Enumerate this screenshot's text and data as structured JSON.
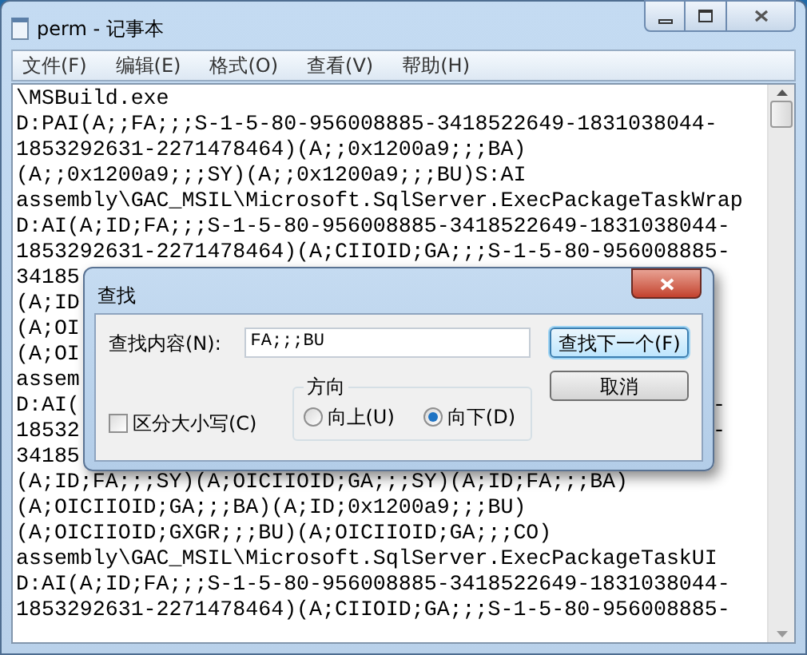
{
  "window": {
    "title": "perm - 记事本"
  },
  "menu": [
    "文件(F)",
    "编辑(E)",
    "格式(O)",
    "查看(V)",
    "帮助(H)"
  ],
  "document_lines": [
    {
      "text": "\\MSBuild.exe"
    },
    {
      "text": "D:PAI(A;;FA;;;S-1-5-80-956008885-3418522649-1831038044-"
    },
    {
      "text": "1853292631-2271478464)(A;;0x1200a9;;;BA)"
    },
    {
      "text": "(A;;0x1200a9;;;SY)(A;;0x1200a9;;;BU)S:AI"
    },
    {
      "text": "assembly\\GAC_MSIL\\Microsoft.SqlServer.ExecPackageTaskWrap"
    },
    {
      "text": "D:AI(A;ID;FA;;;S-1-5-80-956008885-3418522649-1831038044-"
    },
    {
      "text": "1853292631-2271478464)(A;CIIOID;GA;;;S-1-5-80-956008885-"
    },
    {
      "text": "34185"
    },
    {
      "text": "(A;ID"
    },
    {
      "text": "(A;OI"
    },
    {
      "text": "(A;OI"
    },
    {
      "text": "assem"
    },
    {
      "text": "D:AI(",
      "tail": "-"
    },
    {
      "text": "18532",
      "tail": "-"
    },
    {
      "text": "34185"
    },
    {
      "text": "(A;ID;FA;;;SY)(A;OICIIOID;GA;;;SY)(A;ID;FA;;;BA)"
    },
    {
      "text": "(A;OICIIOID;GA;;;BA)(A;ID;0x1200a9;;;BU)"
    },
    {
      "text": "(A;OICIIOID;GXGR;;;BU)(A;OICIIOID;GA;;;CO)"
    },
    {
      "text": "assembly\\GAC_MSIL\\Microsoft.SqlServer.ExecPackageTaskUI"
    },
    {
      "text": "D:AI(A;ID;FA;;;S-1-5-80-956008885-3418522649-1831038044-"
    },
    {
      "text": "1853292631-2271478464)(A;CIIOID;GA;;;S-1-5-80-956008885-"
    }
  ],
  "find_dialog": {
    "title": "查找",
    "find_label": "查找内容(N):",
    "find_value": "FA;;;BU",
    "find_next_button": "查找下一个(F)",
    "cancel_button": "取消",
    "match_case": {
      "label": "区分大小写(C)",
      "checked": false
    },
    "direction": {
      "label": "方向",
      "options": [
        {
          "label": "向上(U)",
          "selected": false
        },
        {
          "label": "向下(D)",
          "selected": true
        }
      ]
    }
  }
}
